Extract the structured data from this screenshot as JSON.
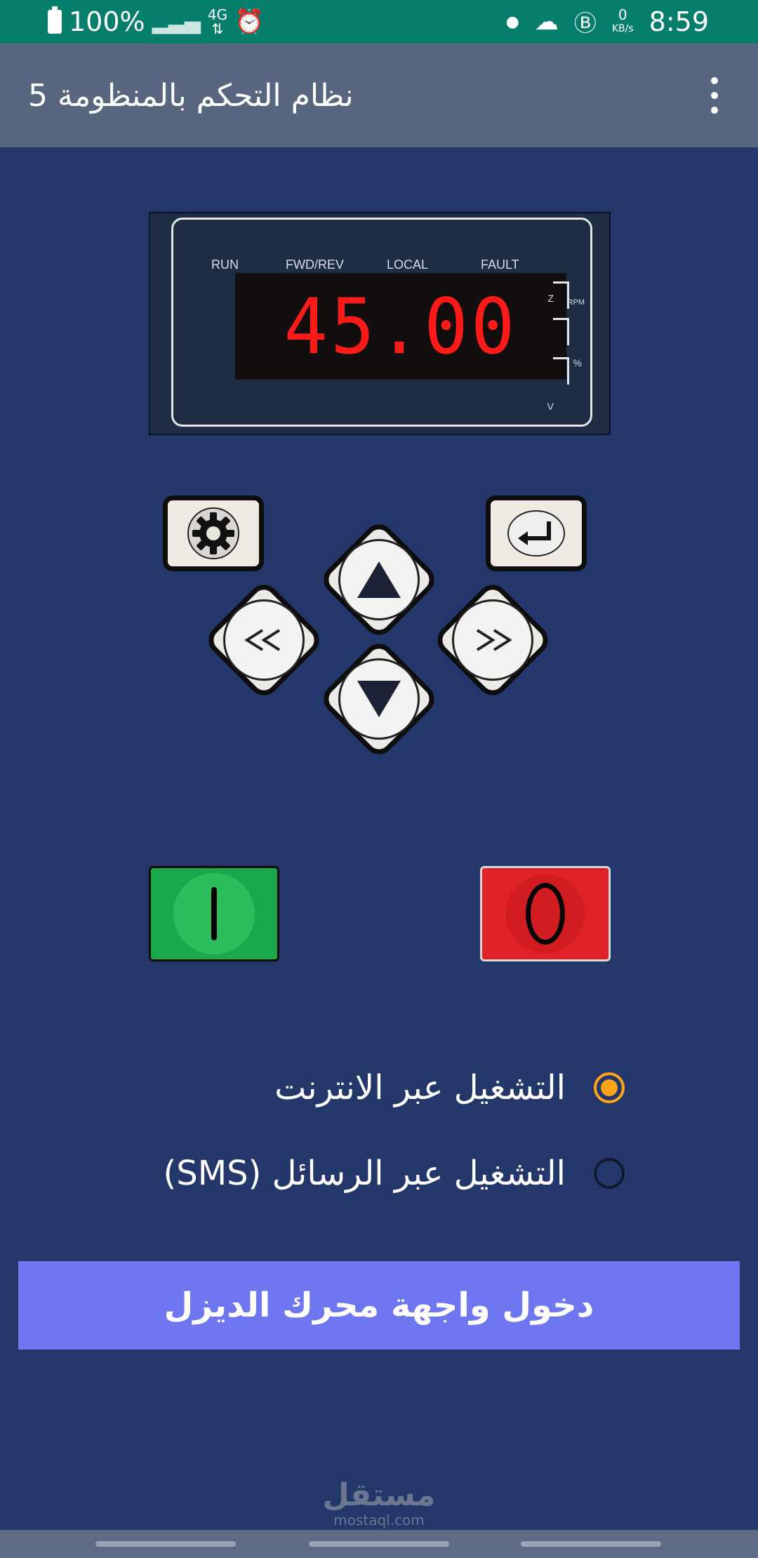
{
  "status_bar": {
    "battery": "100%",
    "network": "4G",
    "kbs_value": "0",
    "kbs_unit": "KB/s",
    "time": "8:59"
  },
  "app_bar": {
    "title": "نظام التحكم بالمنظومة 5"
  },
  "display": {
    "indicators": [
      "RUN",
      "FWD/REV",
      "LOCAL",
      "FAULT"
    ],
    "value": "45.00",
    "unit_rpm": "RPM",
    "unit_percent": "%",
    "unit_v": "V",
    "unit_z": "Z"
  },
  "keypad": {
    "set_icon": "gear-icon",
    "enter_icon": "enter-arrow-icon",
    "up_icon": "triangle-up-icon",
    "down_icon": "triangle-down-icon",
    "left_icon": "double-left-icon",
    "right_icon": "double-right-icon"
  },
  "controls": {
    "start_label": "I",
    "stop_label": "0",
    "start_color": "#19a94a",
    "stop_color": "#e02127"
  },
  "mode": {
    "options": [
      {
        "label": "التشغيل عبر الانترنت",
        "selected": true
      },
      {
        "label": "التشغيل عبر الرسائل (SMS)",
        "selected": false
      }
    ]
  },
  "main_button": {
    "label": "دخول واجهة محرك الديزل",
    "color": "#6e77f0"
  },
  "watermark": {
    "arabic": "مستقل",
    "domain": "mostaql.com"
  }
}
